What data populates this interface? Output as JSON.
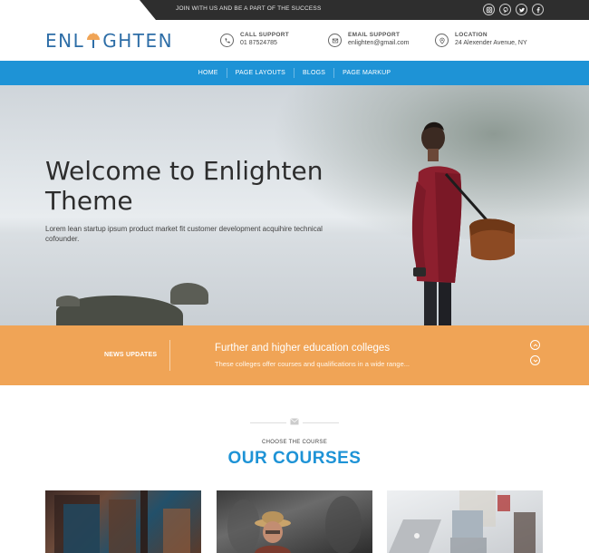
{
  "topbar": {
    "tagline": "JOIN WITH US AND BE A PART OF THE SUCCESS",
    "socials": [
      "instagram-icon",
      "pinterest-icon",
      "twitter-icon",
      "facebook-icon"
    ]
  },
  "header": {
    "logo_left": "ENL",
    "logo_right": "GHTEN",
    "call": {
      "title": "CALL SUPPORT",
      "value": "01 87524785"
    },
    "email": {
      "title": "EMAIL SUPPORT",
      "value": "enlighten@gmail.com"
    },
    "location": {
      "title": "LOCATION",
      "value": "24 Alexender Avenue, NY"
    }
  },
  "nav": {
    "items": [
      "HOME",
      "PAGE LAYOUTS",
      "BLOGS",
      "PAGE MARKUP"
    ]
  },
  "hero": {
    "title_line1": "Welcome to Enlighten",
    "title_line2": "Theme",
    "subtitle": "Lorem lean startup ipsum product market fit customer development acquihire technical cofounder."
  },
  "news": {
    "label": "NEWS UPDATES",
    "title": "Further and higher education colleges",
    "description": "These colleges offer courses and qualifications in a wide range..."
  },
  "courses": {
    "kicker": "CHOOSE THE COURSE",
    "title": "OUR COURSES"
  },
  "colors": {
    "brand_blue": "#1e93d6",
    "news_orange": "#f0a456",
    "topbar_dark": "#2e2e2e"
  }
}
